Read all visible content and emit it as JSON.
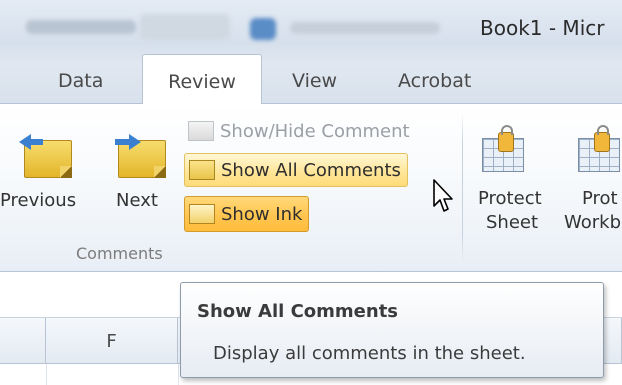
{
  "window": {
    "title": "Book1 - Micr"
  },
  "tabs": [
    {
      "label": "Data"
    },
    {
      "label": "Review"
    },
    {
      "label": "View"
    },
    {
      "label": "Acrobat"
    }
  ],
  "ribbon": {
    "comments_group": {
      "label": "Comments",
      "previous_label": "Previous",
      "next_label": "Next",
      "show_hide_label": "Show/Hide Comment",
      "show_all_label": "Show All Comments",
      "show_ink_label": "Show Ink"
    },
    "protect_group": {
      "protect_sheet_line1": "Protect",
      "protect_sheet_line2": "Sheet",
      "protect_workbook_line1": "Prot",
      "protect_workbook_line2": "Workb"
    }
  },
  "grid": {
    "column_headers": [
      "",
      "F",
      ""
    ]
  },
  "tooltip": {
    "title": "Show All Comments",
    "description": "Display all comments in the sheet."
  },
  "colors": {
    "hover_highlight": "#ffe699",
    "active_highlight": "#ffc550",
    "arrow_blue": "#3a7fd0"
  }
}
